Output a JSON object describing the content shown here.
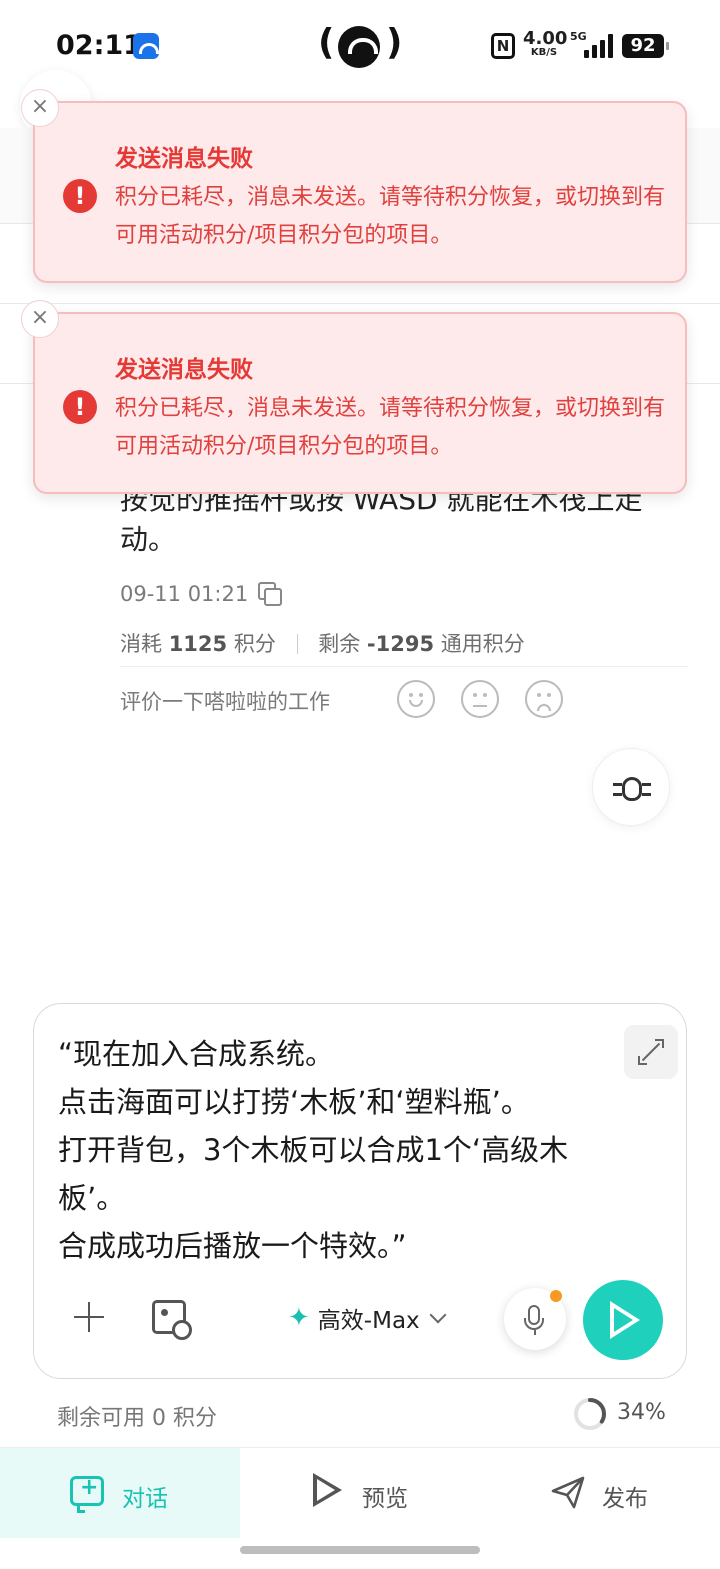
{
  "status_bar": {
    "time": "02:11",
    "network_speed_value": "4.00",
    "network_speed_unit": "KB/S",
    "network_type": "5G",
    "battery": "92",
    "nfc_label": "N"
  },
  "toasts": [
    {
      "title": "发送消息失败",
      "message": "积分已耗尽，消息未发送。请等待积分恢复，或切换到有可用活动积分/项目积分包的项目。"
    },
    {
      "title": "发送消息失败",
      "message": "积分已耗尽，消息未发送。请等待积分恢复，或切换到有可用活动积分/项目积分包的项目。"
    }
  ],
  "message": {
    "partial_line": "按觉的推摇杆或按 WASD 就能在木筏上走",
    "tail_text": "动。",
    "timestamp": "09-11 01:21",
    "consumed_label": "消耗",
    "consumed_value": "1125",
    "consumed_unit": "积分",
    "remaining_label": "剩余",
    "remaining_value": "-1295",
    "remaining_unit": "通用积分",
    "rate_prompt": "评价一下嗒啦啦的工作"
  },
  "composer": {
    "text": "“现在加入合成系统。\n点击海面可以打捞‘木板’和‘塑料瓶’。\n打开背包，3个木板可以合成1个‘高级木板’。\n合成成功后播放一个特效。”",
    "model": "高效-Max"
  },
  "credits": {
    "remaining_text": "剩余可用 0 积分",
    "progress_text": "34%",
    "progress": 0.34
  },
  "tabs": [
    {
      "label": "对话",
      "icon": "chat-plus-icon",
      "active": true
    },
    {
      "label": "预览",
      "icon": "play-icon",
      "active": false
    },
    {
      "label": "发布",
      "icon": "send-icon",
      "active": false
    }
  ],
  "colors": {
    "accent": "#1fd0bd",
    "error": "#e53935",
    "toast_bg": "#feeaea"
  }
}
